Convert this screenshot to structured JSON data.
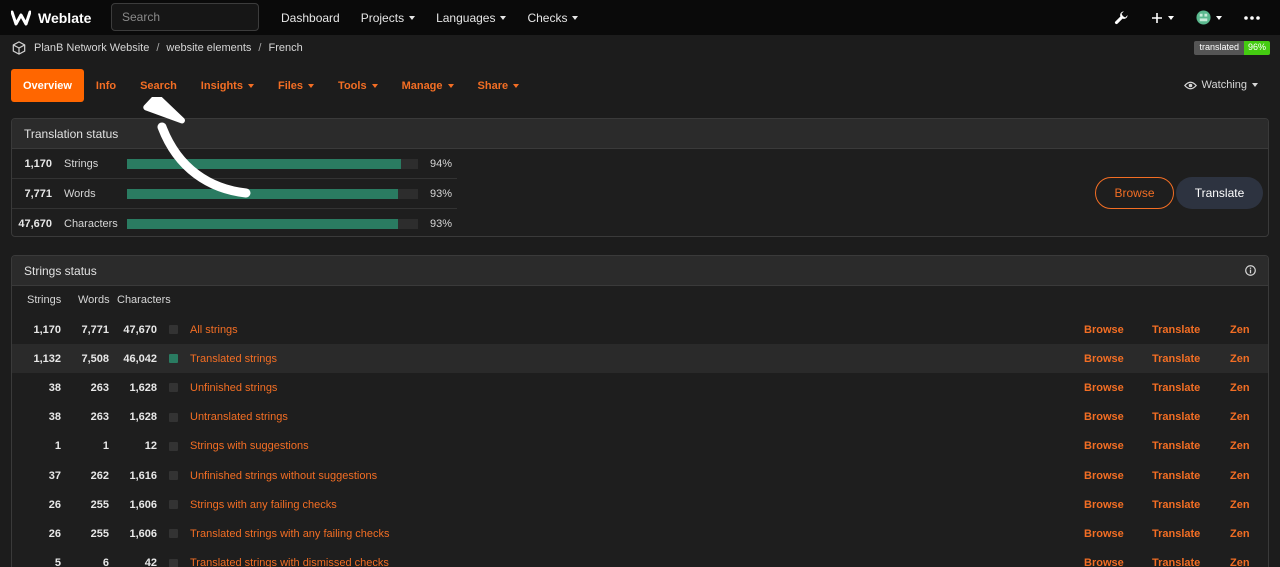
{
  "navbar": {
    "brand": "Weblate",
    "search_placeholder": "Search",
    "menu": [
      {
        "label": "Dashboard",
        "dropdown": false
      },
      {
        "label": "Projects",
        "dropdown": true
      },
      {
        "label": "Languages",
        "dropdown": true
      },
      {
        "label": "Checks",
        "dropdown": true
      }
    ],
    "icons": [
      "wrench-icon",
      "plus-icon",
      "avatar",
      "more-icon"
    ]
  },
  "breadcrumb": {
    "items": [
      "PlanB Network Website",
      "website elements",
      "French"
    ]
  },
  "badge": {
    "label": "translated",
    "value": "96%"
  },
  "tabs": [
    {
      "label": "Overview",
      "active": true
    },
    {
      "label": "Info",
      "dropdown": false
    },
    {
      "label": "Search",
      "dropdown": false
    },
    {
      "label": "Insights",
      "dropdown": true
    },
    {
      "label": "Files",
      "dropdown": true
    },
    {
      "label": "Tools",
      "dropdown": true
    },
    {
      "label": "Manage",
      "dropdown": true
    },
    {
      "label": "Share",
      "dropdown": true
    }
  ],
  "watching": "Watching",
  "translation_status": {
    "title": "Translation status",
    "rows": [
      {
        "count": "1,170",
        "label": "Strings",
        "percent": 94,
        "percent_text": "94%"
      },
      {
        "count": "7,771",
        "label": "Words",
        "percent": 93,
        "percent_text": "93%"
      },
      {
        "count": "47,670",
        "label": "Characters",
        "percent": 93,
        "percent_text": "93%"
      }
    ],
    "browse_label": "Browse",
    "translate_label": "Translate"
  },
  "strings_status": {
    "title": "Strings status",
    "columns": [
      "Strings",
      "Words",
      "Characters"
    ],
    "actions": [
      "Browse",
      "Translate",
      "Zen"
    ],
    "rows": [
      {
        "strings": "1,170",
        "words": "7,771",
        "chars": "47,670",
        "label": "All strings",
        "green": false
      },
      {
        "strings": "1,132",
        "words": "7,508",
        "chars": "46,042",
        "label": "Translated strings",
        "green": true
      },
      {
        "strings": "38",
        "words": "263",
        "chars": "1,628",
        "label": "Unfinished strings",
        "green": false
      },
      {
        "strings": "38",
        "words": "263",
        "chars": "1,628",
        "label": "Untranslated strings",
        "green": false
      },
      {
        "strings": "1",
        "words": "1",
        "chars": "12",
        "label": "Strings with suggestions",
        "green": false
      },
      {
        "strings": "37",
        "words": "262",
        "chars": "1,616",
        "label": "Unfinished strings without suggestions",
        "green": false
      },
      {
        "strings": "26",
        "words": "255",
        "chars": "1,606",
        "label": "Strings with any failing checks",
        "green": false
      },
      {
        "strings": "26",
        "words": "255",
        "chars": "1,606",
        "label": "Translated strings with any failing checks",
        "green": false
      },
      {
        "strings": "5",
        "words": "6",
        "chars": "42",
        "label": "Translated strings with dismissed checks",
        "green": false
      }
    ]
  },
  "colors": {
    "accent": "#f36e24",
    "active_tab": "#ff6600",
    "progress": "#2a7b61",
    "badge_ok": "#44cc11"
  }
}
